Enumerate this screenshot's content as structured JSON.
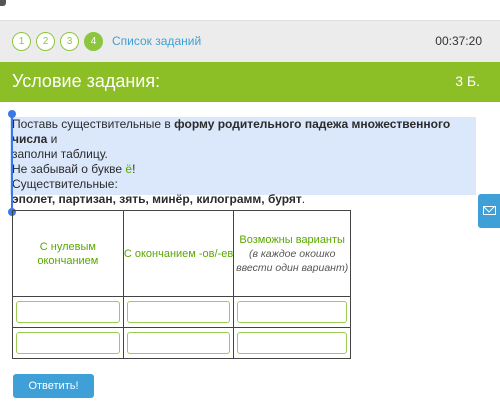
{
  "nav": {
    "steps": [
      "1",
      "2",
      "3",
      "4"
    ],
    "active_step": "4",
    "tasks_link": "Список заданий",
    "timer": "00:37:20"
  },
  "header": {
    "title": "Условие задания:",
    "score": "3 Б."
  },
  "condition": {
    "line1_pre": "Поставь существительные в ",
    "line1_bold": "форму родительного падежа множественного числа",
    "line1_post": " и",
    "line2": "заполни таблицу.",
    "line3_pre": "Не забывай о букве ",
    "line3_letter": "ё",
    "line3_post": "!",
    "line4": "Существительные:",
    "words": "эполет, партизан, зять, минёр, килограмм, бурят",
    "words_end": "."
  },
  "table": {
    "col1": "С нулевым окончанием",
    "col2": "С окончанием -ов/-ев",
    "col3_title": "Возможны варианты",
    "col3_note": "(в каждое окошко ввести один вариант)"
  },
  "submit_label": "Ответить!",
  "colors": {
    "accent_green": "#8cbf26",
    "link_blue": "#3fa0d8",
    "selection": "#dbe8fb"
  }
}
